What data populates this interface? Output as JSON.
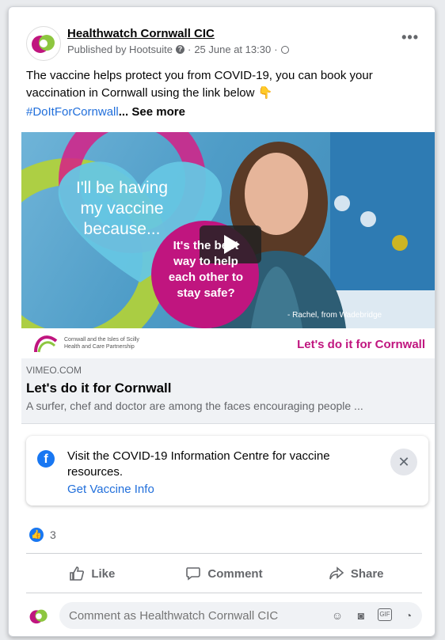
{
  "post": {
    "page_name": "Healthwatch Cornwall CIC",
    "published_by": "Published by Hootsuite",
    "date": "25 June at 13:30",
    "text": "The vaccine helps protect you from COVID-19, you can book your vaccination in Cornwall using the link below 👇",
    "hashtag": "#DoItForCornwall",
    "see_more": "See more"
  },
  "media": {
    "heart_text": "I'll be having my vaccine because...",
    "quote_text": "It's the best way to help each other to stay safe?",
    "caption": "- Rachel, from Wadebridge",
    "partner_text": "Cornwall and the Isles of Scilly Health and Care Partnership",
    "slogan": "Let's do it for Cornwall"
  },
  "link": {
    "domain": "VIMEO.COM",
    "title": "Let's do it for Cornwall",
    "description": "A surfer, chef and doctor are among the faces encouraging people ..."
  },
  "info_box": {
    "text": "Visit the COVID-19 Information Centre for vaccine resources.",
    "link": "Get Vaccine Info"
  },
  "reactions": {
    "count": "3"
  },
  "actions": {
    "like": "Like",
    "comment": "Comment",
    "share": "Share"
  },
  "comment": {
    "placeholder": "Comment as Healthwatch Cornwall CIC"
  },
  "colors": {
    "accent": "#1877f2",
    "magenta": "#c0157f",
    "link": "#216fdb"
  }
}
